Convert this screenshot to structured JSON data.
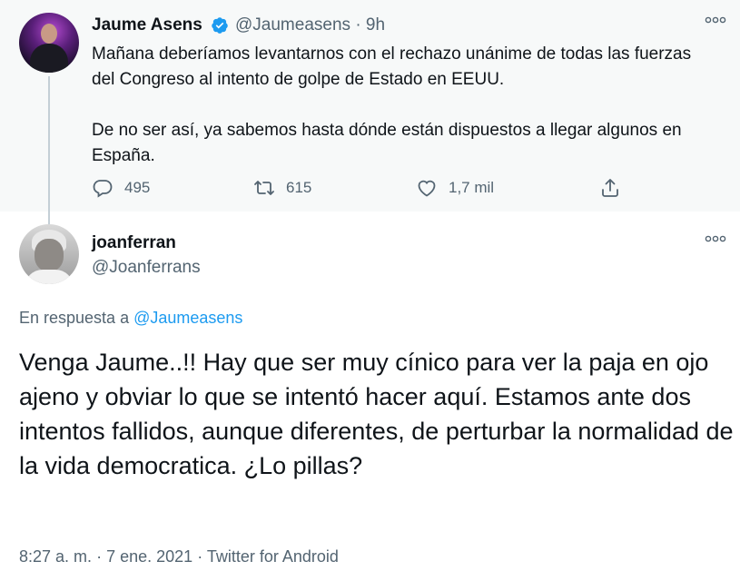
{
  "parent_tweet": {
    "display_name": "Jaume Asens",
    "handle": "@Jaumeasens",
    "separator": "·",
    "time": "9h",
    "text": "Mañana deberíamos levantarnos con el rechazo unánime de todas las fuerzas del Congreso al intento de golpe de Estado en EEUU.\n\nDe no ser así, ya sabemos hasta dónde están dispuestos a llegar algunos en España.",
    "replies": "495",
    "retweets": "615",
    "likes": "1,7 mil",
    "icons": [
      "verified-badge-icon",
      "more-options-icon",
      "reply-icon",
      "retweet-icon",
      "like-icon",
      "share-icon"
    ]
  },
  "reply_tweet": {
    "display_name": "joanferran",
    "handle": "@Joanferrans",
    "in_reply_prefix": "En respuesta a",
    "in_reply_handle": "@Jaumeasens",
    "text": "Venga Jaume..!! Hay que ser muy cínico para ver la paja en ojo ajeno y obviar lo que se intentó hacer aquí. Estamos ante dos intentos fallidos, aunque diferentes, de perturbar la normalidad de la vida democratica. ¿Lo pillas?",
    "time": "8:27 a. m.",
    "date": "7 ene. 2021",
    "source": "Twitter for Android",
    "meta_separator": "·"
  },
  "colors": {
    "accent": "#1d9bf0",
    "secondary_text": "#536471",
    "primary_text": "#0f1419",
    "parent_background": "#f7f9f9"
  }
}
